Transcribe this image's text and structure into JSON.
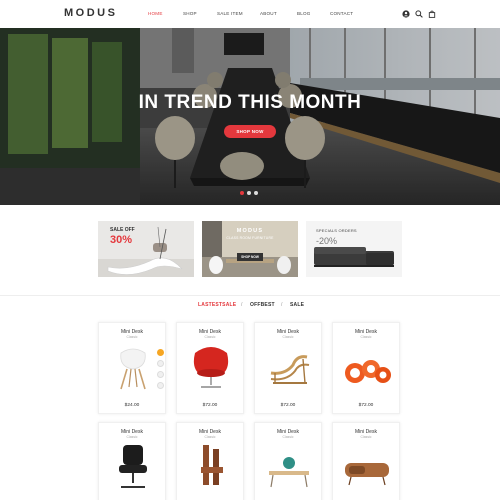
{
  "brand": {
    "logo": "MODUS"
  },
  "nav": [
    {
      "label": "HOME",
      "active": true
    },
    {
      "label": "SHOP",
      "active": false
    },
    {
      "label": "SALE ITEM",
      "active": false
    },
    {
      "label": "ABOUT",
      "active": false
    },
    {
      "label": "BLOG",
      "active": false
    },
    {
      "label": "CONTACT",
      "active": false
    }
  ],
  "header_icons": [
    "user-icon",
    "search-icon",
    "cart-icon"
  ],
  "hero": {
    "title": "IN TREND THIS MONTH",
    "button": "SHOP NOW",
    "slides": 3,
    "active_slide": 1
  },
  "promos": [
    {
      "label": "SALE OFF",
      "value": "30%"
    },
    {
      "logo": "MODUS",
      "subtitle": "CLASS ROOM FURNITURE",
      "button": "SHOP NOW"
    },
    {
      "label": "SPECIALS ORDERS",
      "value": "-20%"
    }
  ],
  "filters": [
    {
      "label": "LASTESTSALE",
      "active": true
    },
    {
      "label": "OFFBEST",
      "active": false
    },
    {
      "label": "SALE",
      "active": false
    }
  ],
  "filter_separator": "/",
  "products": [
    {
      "name": "Mini Desk",
      "category": "Classic",
      "price": "$24.00"
    },
    {
      "name": "Mini Desk",
      "category": "Classic",
      "price": "$72.00"
    },
    {
      "name": "Mini Desk",
      "category": "Classic",
      "price": "$72.00"
    },
    {
      "name": "Mini Desk",
      "category": "Classic",
      "price": "$72.00"
    },
    {
      "name": "Mini Desk",
      "category": "Classic",
      "price": ""
    },
    {
      "name": "Mini Desk",
      "category": "Classic",
      "price": ""
    },
    {
      "name": "Mini Desk",
      "category": "Classic",
      "price": ""
    },
    {
      "name": "Mini Desk",
      "category": "Classic",
      "price": ""
    }
  ],
  "colors": {
    "accent": "#e4383d",
    "cart_button": "#f6a623"
  }
}
